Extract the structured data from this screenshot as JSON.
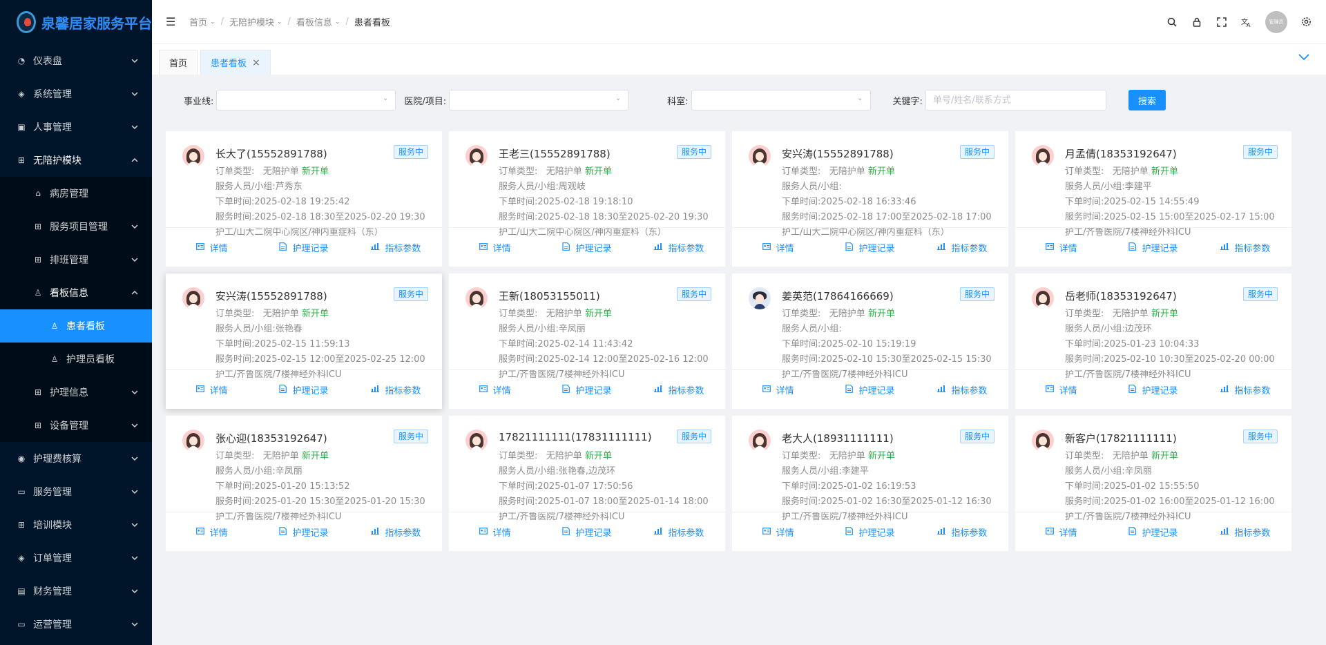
{
  "app": {
    "title": "泉馨居家服务平台"
  },
  "sidebar": {
    "items": [
      {
        "label": "仪表盘",
        "icon": "dashboard-icon",
        "glyph": "◔",
        "expanded": false
      },
      {
        "label": "系统管理",
        "icon": "layers-icon",
        "glyph": "◈",
        "expanded": false
      },
      {
        "label": "人事管理",
        "icon": "briefcase-icon",
        "glyph": "▣",
        "expanded": false
      },
      {
        "label": "无陪护模块",
        "icon": "grid-icon",
        "glyph": "⊞",
        "expanded": true,
        "children": [
          {
            "label": "病房管理",
            "icon": "home-icon",
            "glyph": "⌂"
          },
          {
            "label": "服务项目管理",
            "icon": "grid-icon",
            "glyph": "⊞",
            "expandable": true
          },
          {
            "label": "排班管理",
            "icon": "grid-icon",
            "glyph": "⊞",
            "expandable": true
          },
          {
            "label": "看板信息",
            "icon": "user-icon",
            "glyph": "♙",
            "expanded": true,
            "children": [
              {
                "label": "患者看板",
                "icon": "user-icon",
                "glyph": "♙",
                "active": true
              },
              {
                "label": "护理员看板",
                "icon": "user-icon",
                "glyph": "♙"
              }
            ]
          },
          {
            "label": "护理信息",
            "icon": "grid-icon",
            "glyph": "⊞",
            "expandable": true
          },
          {
            "label": "设备管理",
            "icon": "grid-icon",
            "glyph": "⊞",
            "expandable": true
          }
        ]
      },
      {
        "label": "护理费核算",
        "icon": "coin-icon",
        "glyph": "◉",
        "expanded": false
      },
      {
        "label": "服务管理",
        "icon": "monitor-icon",
        "glyph": "▭",
        "expanded": false
      },
      {
        "label": "培训模块",
        "icon": "grid-icon",
        "glyph": "⊞",
        "expanded": false
      },
      {
        "label": "订单管理",
        "icon": "layers-icon",
        "glyph": "◈",
        "expanded": false
      },
      {
        "label": "财务管理",
        "icon": "ledger-icon",
        "glyph": "▤",
        "expanded": false
      },
      {
        "label": "运营管理",
        "icon": "monitor-check-icon",
        "glyph": "▭",
        "expanded": false
      }
    ]
  },
  "header": {
    "breadcrumb": [
      "首页",
      "无陪护模块",
      "看板信息",
      "患者看板"
    ],
    "avatar_text": "管理员"
  },
  "tabs": [
    {
      "label": "首页",
      "active": false
    },
    {
      "label": "患者看板",
      "active": true
    }
  ],
  "filters": {
    "business_line_label": "事业线:",
    "hospital_label": "医院/项目:",
    "department_label": "科室:",
    "keyword_label": "关键字:",
    "keyword_placeholder": "单号/姓名/联系方式",
    "search_label": "搜索"
  },
  "card_labels": {
    "order_type": "订单类型:",
    "staff": "服务人员/小组:",
    "order_time": "下单时间:",
    "service_time": "服务时间:",
    "detail": "详情",
    "care_record": "护理记录",
    "metrics": "指标参数"
  },
  "cards": [
    {
      "name": "长大了(15552891788)",
      "status": "服务中",
      "order_type": "无陪护单",
      "tag": "新开单",
      "staff": "芦秀东",
      "order_time": "2025-02-18 19:25:42",
      "service_time": "2025-02-18 18:30至2025-02-20 19:30",
      "location": "护工/山大二院中心院区/神内重症科（东）",
      "avatar": "female"
    },
    {
      "name": "王老三(15552891788)",
      "status": "服务中",
      "order_type": "无陪护单",
      "tag": "新开单",
      "staff": "周观岐",
      "order_time": "2025-02-18 19:18:10",
      "service_time": "2025-02-18 18:30至2025-02-20 19:30",
      "location": "护工/山大二院中心院区/神内重症科（东）",
      "avatar": "female"
    },
    {
      "name": "安兴涛(15552891788)",
      "status": "服务中",
      "order_type": "无陪护单",
      "tag": "新开单",
      "staff": "",
      "order_time": "2025-02-18 16:33:46",
      "service_time": "2025-02-18 17:00至2025-02-18 17:00",
      "location": "护工/山大二院中心院区/神内重症科（东）",
      "avatar": "female"
    },
    {
      "name": "月孟倩(18353192647)",
      "status": "服务中",
      "order_type": "无陪护单",
      "tag": "新开单",
      "staff": "李建平",
      "order_time": "2025-02-15 14:55:49",
      "service_time": "2025-02-15 15:00至2025-02-17 15:00",
      "location": "护工/齐鲁医院/7楼神经外科ICU",
      "avatar": "female"
    },
    {
      "name": "安兴涛(15552891788)",
      "status": "服务中",
      "order_type": "无陪护单",
      "tag": "新开单",
      "staff": "张艳春",
      "order_time": "2025-02-15 11:59:13",
      "service_time": "2025-02-15 12:00至2025-02-25 12:00",
      "location": "护工/齐鲁医院/7楼神经外科ICU",
      "avatar": "female",
      "elevated": true
    },
    {
      "name": "王新(18053155011)",
      "status": "服务中",
      "order_type": "无陪护单",
      "tag": "新开单",
      "staff": "辛凤丽",
      "order_time": "2025-02-14 11:43:42",
      "service_time": "2025-02-14 12:00至2025-02-16 12:00",
      "location": "护工/齐鲁医院/7楼神经外科ICU",
      "avatar": "female"
    },
    {
      "name": "姜英范(17864166669)",
      "status": "服务中",
      "order_type": "无陪护单",
      "tag": "新开单",
      "staff": "",
      "order_time": "2025-02-10 15:19:19",
      "service_time": "2025-02-10 15:30至2025-02-15 15:30",
      "location": "护工/齐鲁医院/7楼神经外科ICU",
      "avatar": "male"
    },
    {
      "name": "岳老师(18353192647)",
      "status": "服务中",
      "order_type": "无陪护单",
      "tag": "新开单",
      "staff": "边茂环",
      "order_time": "2025-01-23 10:04:33",
      "service_time": "2025-02-10 10:30至2025-02-20 00:00",
      "location": "护工/齐鲁医院/7楼神经外科ICU",
      "avatar": "female"
    },
    {
      "name": "张心迎(18353192647)",
      "status": "服务中",
      "order_type": "无陪护单",
      "tag": "新开单",
      "staff": "辛凤丽",
      "order_time": "2025-01-20 15:13:52",
      "service_time": "2025-01-20 15:30至2025-01-20 15:30",
      "location": "护工/齐鲁医院/7楼神经外科ICU",
      "avatar": "female"
    },
    {
      "name": "17821111111(17831111111)",
      "status": "服务中",
      "order_type": "无陪护单",
      "tag": "新开单",
      "staff": "张艳春,边茂环",
      "order_time": "2025-01-07 17:50:56",
      "service_time": "2025-01-07 18:00至2025-01-14 18:00",
      "location": "护工/齐鲁医院/7楼神经外科ICU",
      "avatar": "female"
    },
    {
      "name": "老大人(18931111111)",
      "status": "服务中",
      "order_type": "无陪护单",
      "tag": "新开单",
      "staff": "李建平",
      "order_time": "2025-01-02 16:19:53",
      "service_time": "2025-01-02 16:30至2025-01-12 16:30",
      "location": "护工/齐鲁医院/7楼神经外科ICU",
      "avatar": "female"
    },
    {
      "name": "新客户(17821111111)",
      "status": "服务中",
      "order_type": "无陪护单",
      "tag": "新开单",
      "staff": "辛凤丽",
      "order_time": "2025-01-02 15:55:50",
      "service_time": "2025-01-02 16:00至2025-01-12 16:00",
      "location": "护工/齐鲁医院/7楼神经外科ICU",
      "avatar": "female"
    }
  ],
  "colors": {
    "accent": "#1890ff",
    "sidebar_bg": "#001529",
    "new_tag": "#2fb048"
  }
}
